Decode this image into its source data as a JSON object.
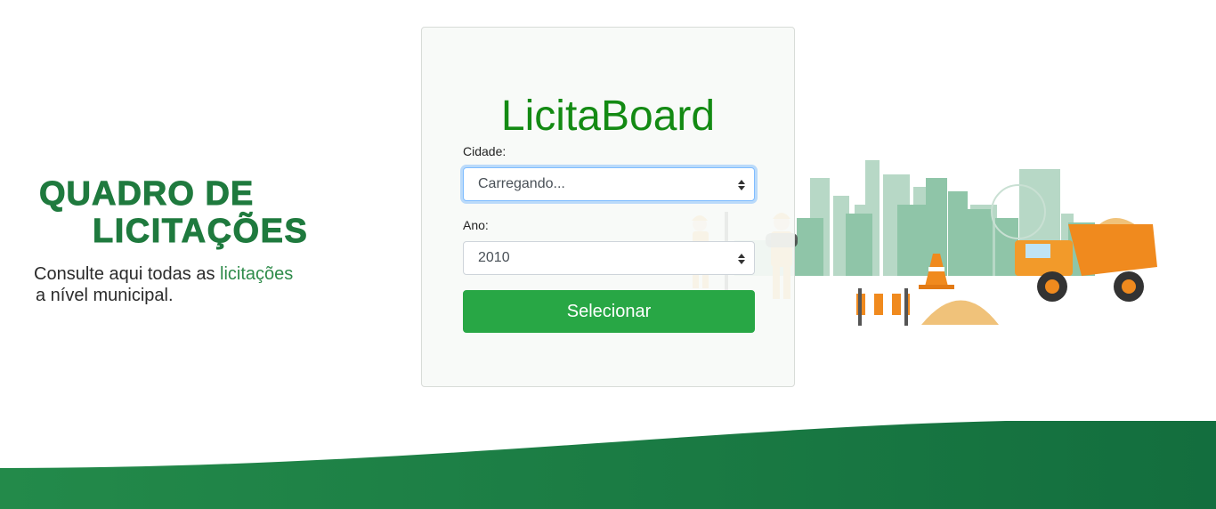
{
  "hero": {
    "title_line1": "QUADRO DE",
    "title_line2": "LICITAÇÕES",
    "subtitle_part1": "Consulte aqui todas as ",
    "subtitle_highlight": "licitações",
    "subtitle_line2": "a nível  municipal."
  },
  "card": {
    "title": "LicitaBoard",
    "city_label": "Cidade:",
    "city_value": "Carregando...",
    "year_label": "Ano:",
    "year_value": "2010",
    "submit_label": "Selecionar"
  },
  "colors": {
    "brand_green": "#138a13",
    "hero_green": "#1f7a3e",
    "button_green": "#28a745",
    "wave_green": "#1e7a44"
  },
  "icons": {
    "select_arrows": "sort-arrows-icon"
  }
}
